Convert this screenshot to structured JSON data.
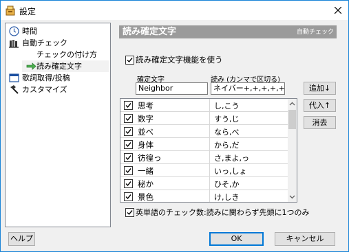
{
  "window": {
    "title": "設定"
  },
  "tree": {
    "items": [
      {
        "label": "時間",
        "icon": "clock-icon"
      },
      {
        "label": "自動チェック",
        "icon": "books-icon"
      },
      {
        "label": "チェックの付け方",
        "icon": ""
      },
      {
        "label": "読み確定文字",
        "icon": "green-arrow-icon"
      },
      {
        "label": "歌詞取得/投稿",
        "icon": "window-icon"
      },
      {
        "label": "カスタマイズ",
        "icon": "hammer-icon"
      }
    ],
    "selected": "読み確定文字"
  },
  "panel": {
    "title": "読み確定文字",
    "subtitle": "自動チェック",
    "enable_label": "読み確定文字機能を使う",
    "col_word_label": "確定文字",
    "col_reading_label": "読み (カンマで区切る)",
    "word_value": "Neighbor",
    "reading_value": "ネイバー+,+,+,+,+",
    "buttons": {
      "add": "追加↓",
      "replace": "代入↑",
      "delete": "消去"
    },
    "rows": [
      {
        "word": "思考",
        "reading": "し,こう"
      },
      {
        "word": "数字",
        "reading": "すう,じ"
      },
      {
        "word": "並べ",
        "reading": "なら,べ"
      },
      {
        "word": "身体",
        "reading": "から,だ"
      },
      {
        "word": "彷徨っ",
        "reading": "さ,まよ,っ"
      },
      {
        "word": "一緒",
        "reading": "いっ,しょ"
      },
      {
        "word": "秘か",
        "reading": "ひそ,か"
      },
      {
        "word": "景色",
        "reading": "け,しき"
      }
    ],
    "english_check_label": "英単語のチェック数:読みに関わらず先頭に1つのみ"
  },
  "footer": {
    "help": "ヘルプ",
    "ok": "OK",
    "cancel": "キャンセル"
  },
  "colors": {
    "accent": "#0078d7",
    "header_bg": "#9b9b9b"
  }
}
